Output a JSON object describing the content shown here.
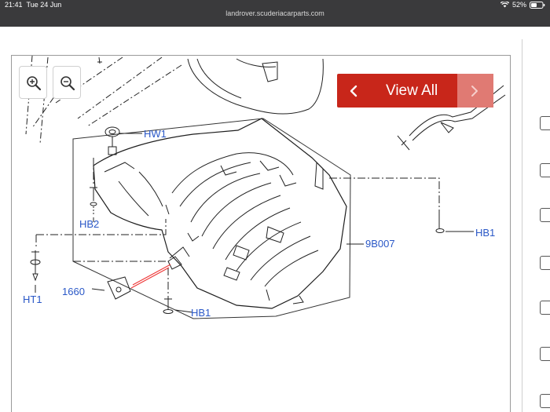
{
  "status_bar": {
    "time": "21:41",
    "date": "Tue 24 Jun",
    "battery_percent": "52%",
    "battery_level": 0.52
  },
  "browser": {
    "url": "landrover.scuderiacarparts.com"
  },
  "zoom_controls": {
    "zoom_in_icon": "zoom-in-magnifier",
    "zoom_out_icon": "zoom-out-magnifier"
  },
  "view_all": {
    "label": "View All",
    "prev_icon": "chevron-left",
    "next_icon": "chevron-right",
    "color": "#c8261a"
  },
  "diagram": {
    "callouts": {
      "hw1": "HW1",
      "hb2": "HB2",
      "ht1": "HT1",
      "c1660": "1660",
      "hb1_bottom": "HB1",
      "c9b007": "9B007",
      "hb1_right": "HB1"
    },
    "callout_color": "#2a58c7"
  },
  "right_panel": {
    "checkbox_count": 7
  }
}
